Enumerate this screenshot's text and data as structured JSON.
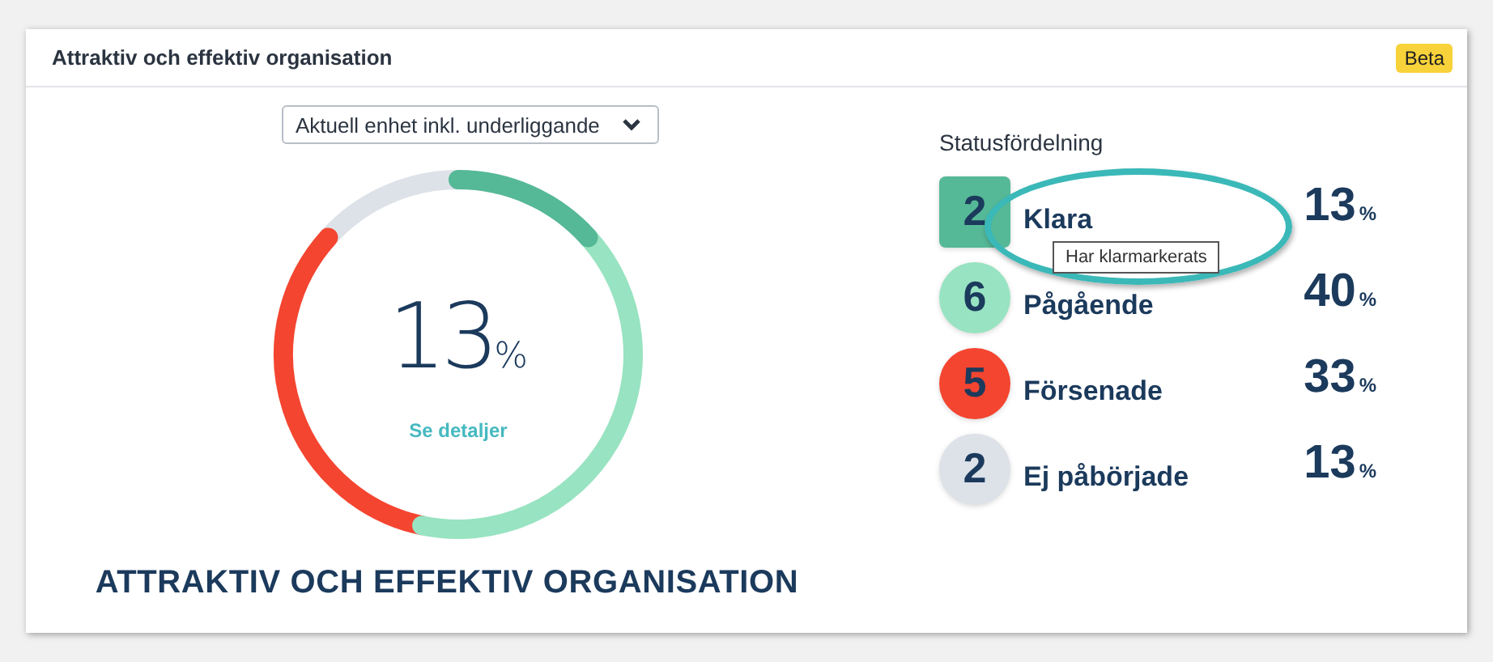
{
  "card": {
    "title": "Attraktiv och effektiv organisation",
    "badge": "Beta"
  },
  "scope_dropdown": {
    "value": "Aktuell enhet inkl. underliggande"
  },
  "summary": {
    "percent": "13",
    "unit": "%",
    "link": "Se detaljer",
    "heading": "ATTRAKTIV OCH EFFEKTIV ORGANISATION"
  },
  "status": {
    "title": "Statusfördelning",
    "items": [
      {
        "count": "2",
        "label": "Klara",
        "percent": "13",
        "unit": "%",
        "color": "#55b896",
        "selected": true
      },
      {
        "count": "6",
        "label": "Pågående",
        "percent": "40",
        "unit": "%",
        "color": "#98e3c1",
        "selected": false
      },
      {
        "count": "5",
        "label": "Försenade",
        "percent": "33",
        "unit": "%",
        "color": "#f44530",
        "selected": false
      },
      {
        "count": "2",
        "label": "Ej påbörjade",
        "percent": "13",
        "unit": "%",
        "color": "#dde2e8",
        "selected": false
      }
    ],
    "tooltip": "Har klarmarkerats"
  }
}
